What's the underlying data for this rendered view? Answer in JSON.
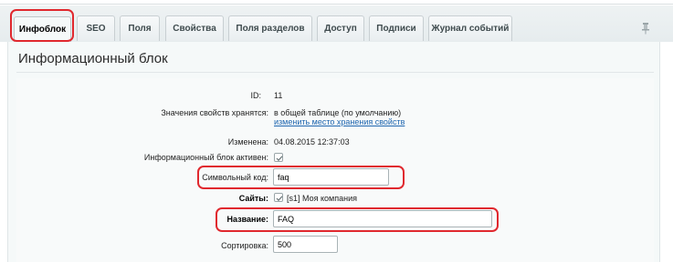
{
  "tabs": [
    {
      "label": "Инфоблок",
      "active": true
    },
    {
      "label": "SEO"
    },
    {
      "label": "Поля"
    },
    {
      "label": "Свойства"
    },
    {
      "label": "Поля разделов"
    },
    {
      "label": "Доступ"
    },
    {
      "label": "Подписи"
    },
    {
      "label": "Журнал событий"
    }
  ],
  "page_title": "Информационный блок",
  "form": {
    "id": {
      "label": "ID:",
      "value": "11"
    },
    "storage": {
      "label": "Значения свойств хранятся:",
      "value": "в общей таблице (по умолчанию)",
      "link": "изменить место хранения свойств"
    },
    "modified": {
      "label": "Изменена:",
      "value": "04.08.2015 12:37:03"
    },
    "active": {
      "label": "Информационный блок активен:",
      "checked": true
    },
    "code": {
      "label": "Символьный код:",
      "value": "faq"
    },
    "sites": {
      "label": "Сайты:",
      "value": "[s1] Моя компания",
      "checked": true
    },
    "name": {
      "label": "Название:",
      "value": "FAQ"
    },
    "sort": {
      "label": "Сортировка:",
      "value": "500"
    }
  },
  "icons": {
    "pin": "pin-icon"
  },
  "colors": {
    "highlight": "#e0282e",
    "link": "#2067b0"
  }
}
